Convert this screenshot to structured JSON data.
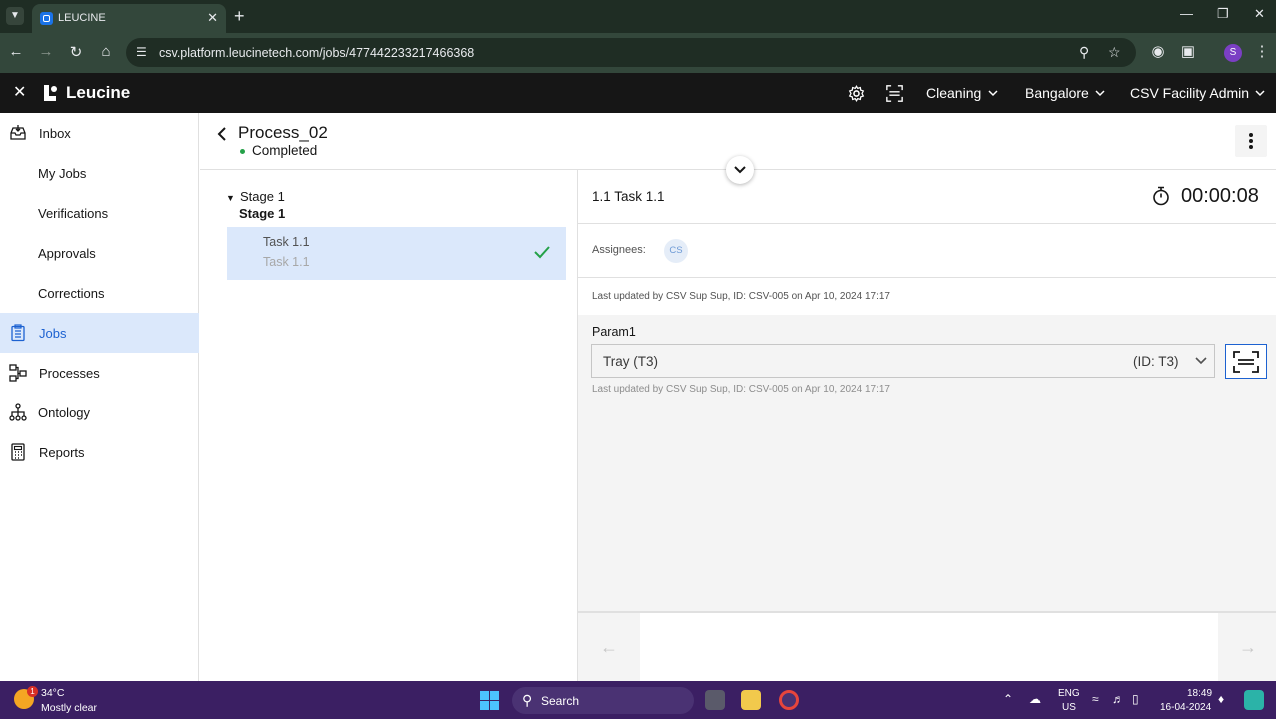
{
  "browser": {
    "tab_title": "LEUCINE",
    "url": "csv.platform.leucinetech.com/jobs/477442233217466368",
    "profile_initial": "S"
  },
  "app": {
    "brand": "Leucine",
    "use_case": "Cleaning",
    "facility": "Bangalore",
    "role": "CSV Facility Admin"
  },
  "sidebar": {
    "items": [
      {
        "label": "Inbox",
        "icon": "inbox-icon"
      },
      {
        "label": "My Jobs"
      },
      {
        "label": "Verifications"
      },
      {
        "label": "Approvals"
      },
      {
        "label": "Corrections"
      },
      {
        "label": "Jobs",
        "icon": "clipboard-icon",
        "active": true
      },
      {
        "label": "Processes",
        "icon": "processes-icon"
      },
      {
        "label": "Ontology",
        "icon": "ontology-icon"
      },
      {
        "label": "Reports",
        "icon": "reports-icon"
      }
    ]
  },
  "job": {
    "title": "Process_02",
    "status": "Completed"
  },
  "stages": {
    "stage_label": "Stage 1",
    "stage_name": "Stage 1",
    "task": {
      "title": "Task 1.1",
      "subtitle": "Task 1.1"
    }
  },
  "task": {
    "title": "1.1 Task 1.1",
    "timer": "00:00:08",
    "assignees_label": "Assignees:",
    "assignee_initials": "CS",
    "last_updated": "Last updated by CSV Sup Sup, ID: CSV-005 on Apr 10, 2024 17:17",
    "param": {
      "label": "Param1",
      "value": "Tray (T3)",
      "id": "(ID: T3)",
      "last_updated": "Last updated by CSV Sup Sup, ID: CSV-005 on Apr 10, 2024 17:17"
    }
  },
  "taskbar": {
    "temperature": "34°C",
    "weather": "Mostly clear",
    "weather_badge": "1",
    "search": "Search",
    "lang_top": "ENG",
    "lang_bottom": "US",
    "time": "18:49",
    "date": "16-04-2024"
  },
  "colors": {
    "accent": "#1d62d1",
    "active_bg": "#dbe8fb",
    "header_bg": "#161616",
    "success": "#24a148",
    "taskbar": "#3b1f63",
    "browser_chrome": "#33473b"
  }
}
